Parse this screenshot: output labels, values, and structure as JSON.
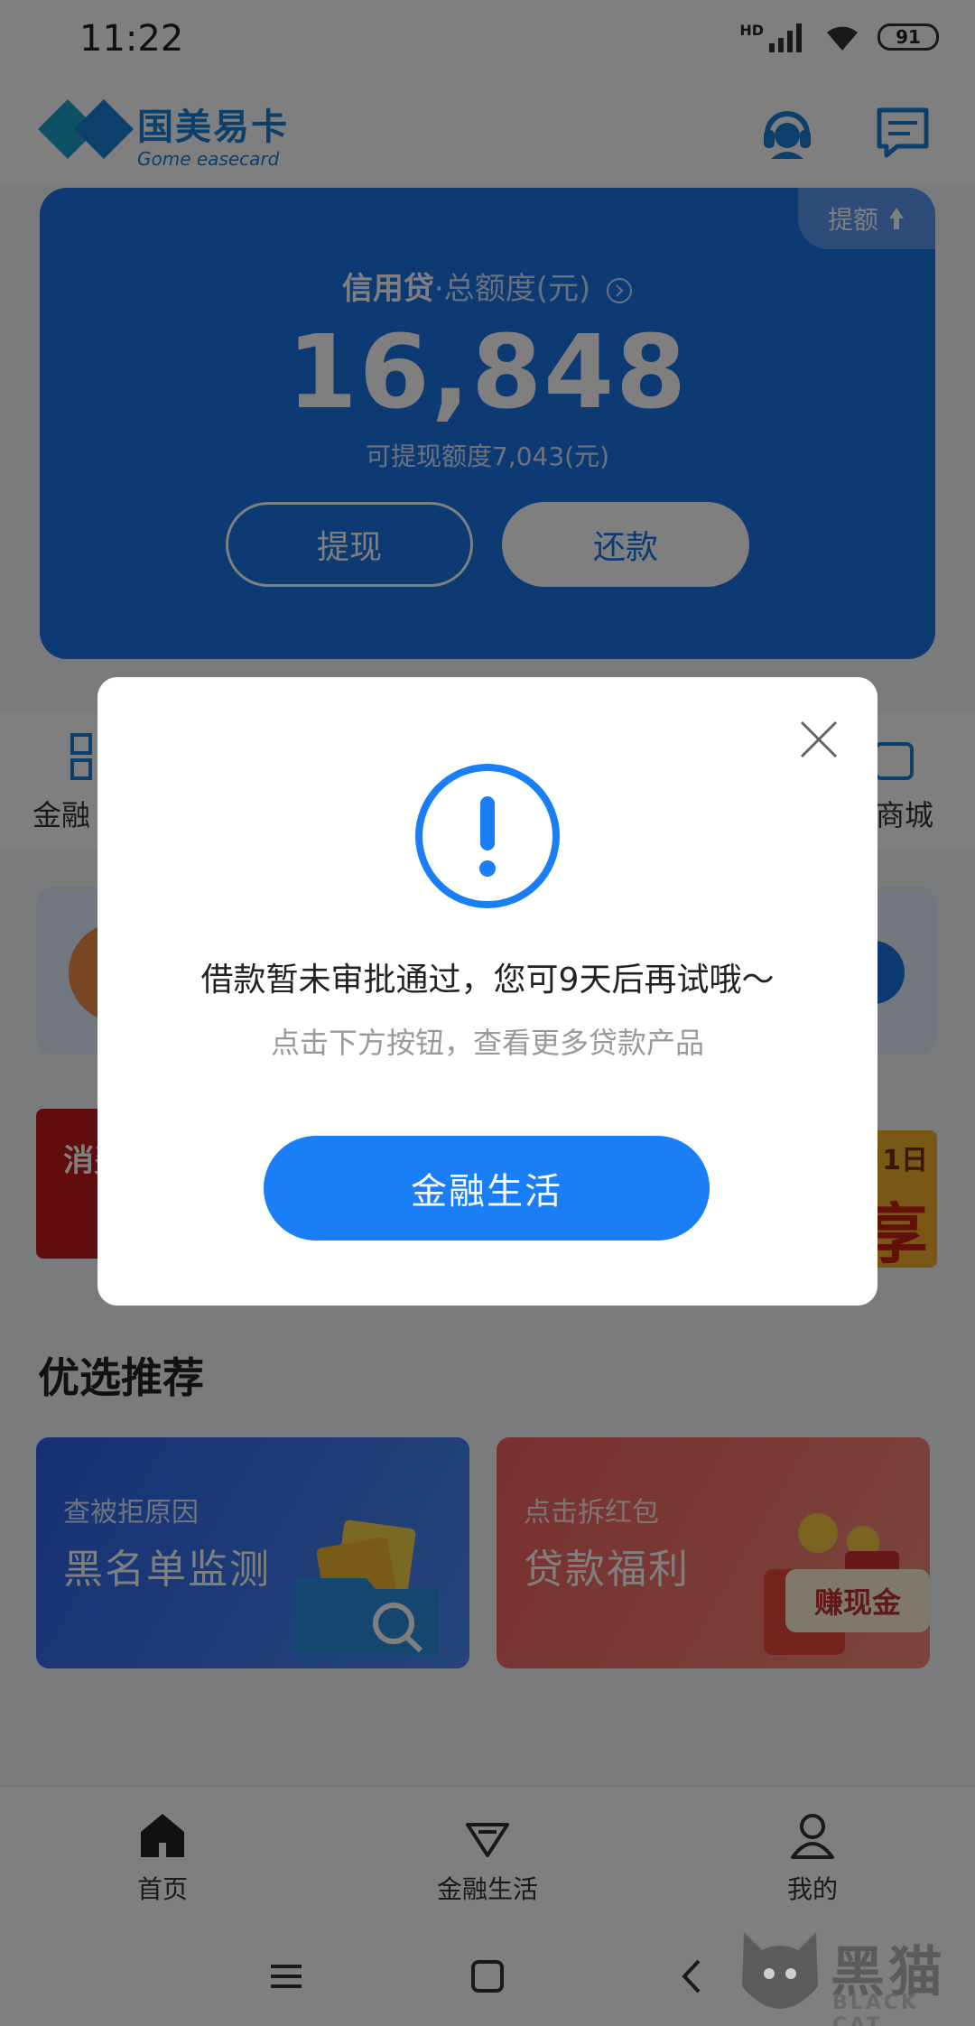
{
  "status_bar": {
    "time": "11:22",
    "battery": "91",
    "hd_label": "HD"
  },
  "header": {
    "logo_cn": "国美易卡",
    "logo_en": "Gome easecard",
    "icons": [
      "customer-service-icon",
      "message-icon"
    ]
  },
  "credit_card": {
    "raise_label": "提额",
    "title_product": "信用贷",
    "title_suffix": "·总额度(元)",
    "total_amount": "16,848",
    "available_text": "可提现额度7,043(元)",
    "withdraw_label": "提现",
    "repay_label": "还款",
    "accent_color": "#1d74e8"
  },
  "quick_nav": {
    "left_label": "金融",
    "right_label": "商城"
  },
  "banner": {
    "left_text": "消费",
    "right_top": "月1日",
    "right_big": "享"
  },
  "recommend": {
    "title": "优选推荐",
    "cards": [
      {
        "sub": "查被拒原因",
        "title": "黑名单监测",
        "badge": ""
      },
      {
        "sub": "点击拆红包",
        "title": "贷款福利",
        "badge": "赚现金"
      }
    ]
  },
  "tabbar": {
    "items": [
      {
        "label": "首页",
        "icon": "home-icon"
      },
      {
        "label": "金融生活",
        "icon": "diamond-icon"
      },
      {
        "label": "我的",
        "icon": "profile-icon"
      }
    ]
  },
  "watermark": {
    "cn": "黑猫",
    "en": "BLACK CAT"
  },
  "dialog": {
    "message": "借款暂未审批通过，您可9天后再试哦～",
    "sub_message": "点击下方按钮，查看更多贷款产品",
    "button_label": "金融生活",
    "icon": "alert-icon",
    "accent_color": "#1a7ff6"
  }
}
